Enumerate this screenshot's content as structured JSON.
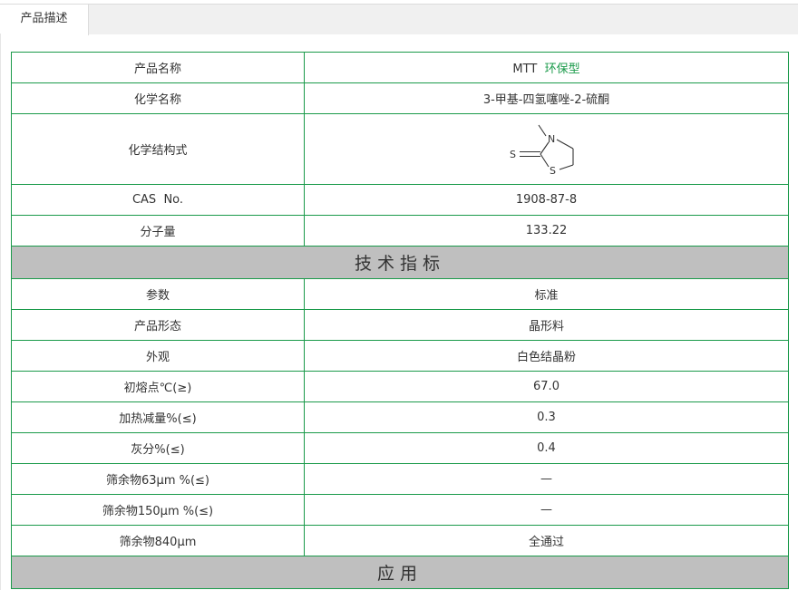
{
  "tabs": [
    {
      "label": "产品描述",
      "active": true
    }
  ],
  "product": {
    "rows": [
      {
        "label": "产品名称",
        "value": "MTT",
        "value_extra": "环保型"
      },
      {
        "label": "化学名称",
        "value": "3-甲基-四氢噻唑-2-硫酮"
      },
      {
        "label": "化学结构式",
        "structure_atoms": {
          "s_exo": "S",
          "n": "N",
          "s_ring": "S"
        }
      },
      {
        "label": "CAS  No.",
        "value": "1908-87-8"
      },
      {
        "label": "分子量",
        "value": "133.22"
      }
    ]
  },
  "technical": {
    "title": "技术指标",
    "header": {
      "param": "参数",
      "standard": "标准"
    },
    "rows": [
      {
        "param": "产品形态",
        "standard": "晶形料"
      },
      {
        "param": "外观",
        "standard": "白色结晶粉"
      },
      {
        "param": "初熔点℃(≥)",
        "standard": "67.0"
      },
      {
        "param": "加热减量%(≤)",
        "standard": "0.3"
      },
      {
        "param": "灰分%(≤)",
        "standard": "0.4"
      },
      {
        "param": "筛余物63μm %(≤)",
        "standard": "—"
      },
      {
        "param": "筛余物150μm %(≤)",
        "standard": "—"
      },
      {
        "param": "筛余物840μm",
        "standard": "全通过"
      }
    ]
  },
  "application": {
    "title": "应用"
  },
  "colors": {
    "border": "#1a9a4a",
    "highlight_text": "#1a9a4a",
    "section_bg": "#bfbfbf"
  }
}
